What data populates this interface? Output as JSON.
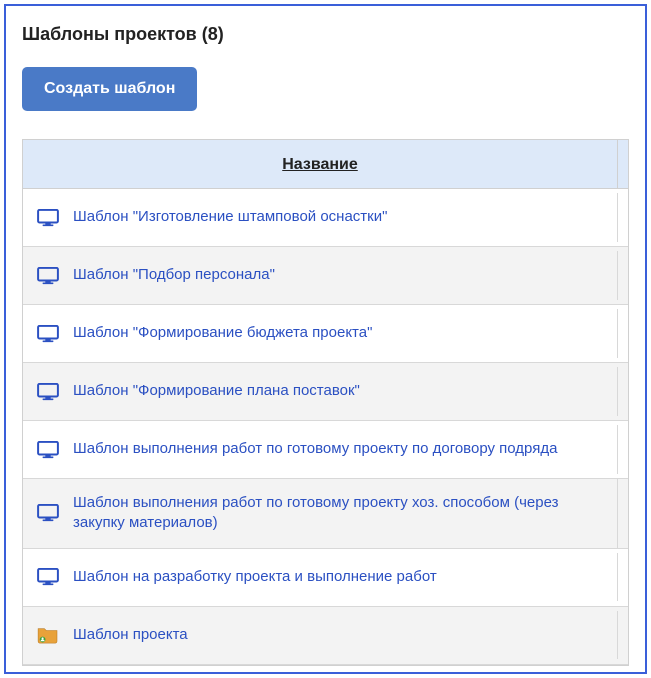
{
  "header": {
    "title": "Шаблоны проектов (8)"
  },
  "actions": {
    "create_label": "Создать шаблон"
  },
  "table": {
    "columns": {
      "name": "Название"
    },
    "rows": [
      {
        "icon": "monitor",
        "label": "Шаблон \"Изготовление штамповой оснастки\""
      },
      {
        "icon": "monitor",
        "label": "Шаблон \"Подбор персонала\""
      },
      {
        "icon": "monitor",
        "label": "Шаблон \"Формирование бюджета проекта\""
      },
      {
        "icon": "monitor",
        "label": "Шаблон \"Формирование плана поставок\""
      },
      {
        "icon": "monitor",
        "label": "Шаблон выполнения работ по готовому проекту по договору подряда"
      },
      {
        "icon": "monitor",
        "label": "Шаблон выполнения работ по готовому проекту хоз. способом (через закупку материалов)"
      },
      {
        "icon": "monitor",
        "label": "Шаблон на разработку проекта и выполнение работ"
      },
      {
        "icon": "folder-user",
        "label": "Шаблон проекта"
      }
    ]
  },
  "icons": {
    "monitor_color": "#2b50c2",
    "folder_color": "#e8a23a",
    "folder_badge": "#3aa03a"
  }
}
